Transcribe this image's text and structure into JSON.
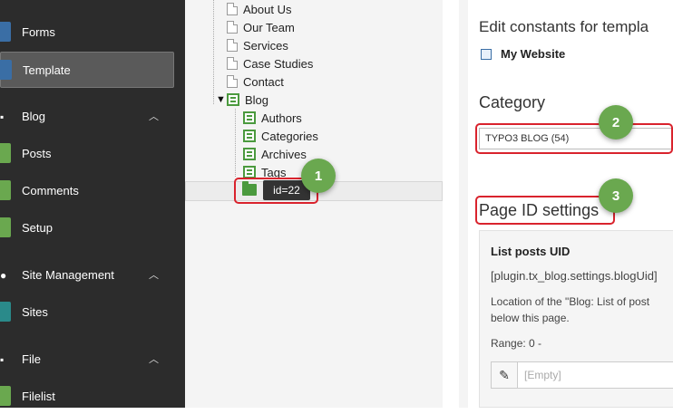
{
  "sidebar": {
    "items": [
      {
        "label": "Forms",
        "icon": "forms-icon",
        "color": "#3a6ea5"
      },
      {
        "label": "Template",
        "icon": "template-icon",
        "color": "#3a6ea5",
        "active": true
      },
      {
        "label": "Blog",
        "icon": "blog-icon",
        "section": true,
        "chevron": "^"
      },
      {
        "label": "Posts",
        "icon": "posts-icon",
        "color": "#6aa84f"
      },
      {
        "label": "Comments",
        "icon": "comments-icon",
        "color": "#6aa84f"
      },
      {
        "label": "Setup",
        "icon": "setup-icon",
        "color": "#6aa84f"
      },
      {
        "label": "Site Management",
        "icon": "globe-icon",
        "section": true,
        "chevron": "^"
      },
      {
        "label": "Sites",
        "icon": "sites-icon",
        "color": "#2a8a8a"
      },
      {
        "label": "File",
        "icon": "file-icon",
        "section": true,
        "chevron": "^"
      },
      {
        "label": "Filelist",
        "icon": "filelist-icon",
        "color": "#6aa84f"
      }
    ]
  },
  "tree": {
    "nodes": [
      {
        "label": "About Us"
      },
      {
        "label": "Our Team"
      },
      {
        "label": "Services"
      },
      {
        "label": "Case Studies"
      },
      {
        "label": "Contact"
      },
      {
        "label": "Blog",
        "expand": "▼"
      },
      {
        "label": "Authors"
      },
      {
        "label": "Categories"
      },
      {
        "label": "Archives"
      },
      {
        "label": "Tags"
      }
    ],
    "tooltip": "id=22"
  },
  "content": {
    "heading": "Edit constants for templa",
    "site_name": "My Website",
    "category_heading": "Category",
    "category_value": "TYPO3 BLOG (54)",
    "page_id_heading": "Page ID settings",
    "card": {
      "title": "List posts UID",
      "code": "[plugin.tx_blog.settings.blogUid]",
      "desc_line1": "Location of the \"Blog: List of post",
      "desc_line2": "below this page.",
      "range": "Range: 0 -",
      "input_placeholder": "[Empty]"
    }
  },
  "annotations": [
    "1",
    "2",
    "3"
  ],
  "colors": {
    "sidebar_bg": "#2c2c2c",
    "accent_green": "#6aa84f",
    "annotation_red": "#d9232d"
  }
}
